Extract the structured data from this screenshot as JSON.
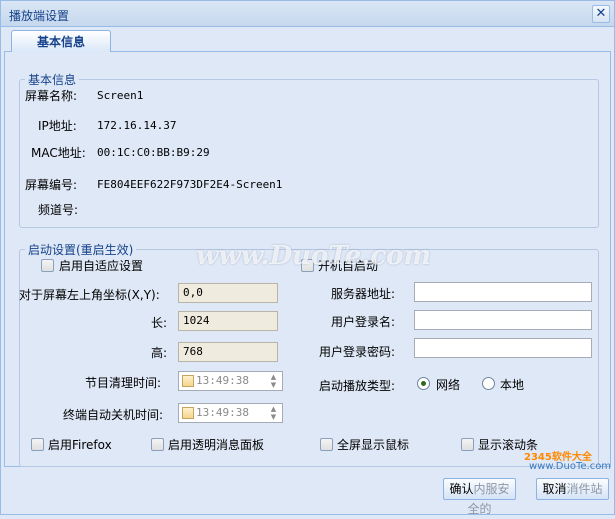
{
  "window": {
    "title": "播放端设置",
    "close_glyph": "✕"
  },
  "tabs": [
    {
      "label": "基本信息",
      "active": true
    }
  ],
  "basic": {
    "legend": "基本信息",
    "rows": [
      {
        "label": "屏幕名称:",
        "value": "Screen1"
      },
      {
        "label": "IP地址:",
        "value": "172.16.14.37"
      },
      {
        "label": "MAC地址:",
        "value": "00:1C:C0:BB:B9:29"
      },
      {
        "label": "屏幕编号:",
        "value": "FE804EEF622F973DF2E4-Screen1"
      },
      {
        "label": "频道号:",
        "value": ""
      }
    ]
  },
  "startup": {
    "legend": "启动设置(重启生效)",
    "adaptive_label": "启用自适应设置",
    "autostart_label": "开机自启动",
    "coord_label": "对于屏幕左上角坐标(X,Y):",
    "coord_value": "0,0",
    "length_label": "长:",
    "length_value": "1024",
    "height_label": "高:",
    "height_value": "768",
    "clear_time_label": "节目清理时间:",
    "clear_time_value": "13:49:38",
    "shutdown_time_label": "终端自动关机时间:",
    "shutdown_time_value": "13:49:38",
    "server_label": "服务器地址:",
    "server_value": "",
    "user_label": "用户登录名:",
    "user_value": "",
    "password_label": "用户登录密码:",
    "password_value": "",
    "play_type_label": "启动播放类型:",
    "play_type_options": [
      "网络",
      "本地"
    ],
    "play_type_selected": "网络",
    "firefox_label": "启用Firefox",
    "transparent_label": "启用透明消息面板",
    "fullscreen_mouse_label": "全屏显示鼠标",
    "scrollbar_label": "显示滚动条"
  },
  "buttons": {
    "ok": "确认",
    "cancel": "取消",
    "ok_suffix": "内服安全的",
    "cancel_suffix": "消件站"
  },
  "watermarks": {
    "main": "www.DuoTe.com",
    "brand": "2345软件大全",
    "brand_url": "www.DuoTe.com"
  }
}
